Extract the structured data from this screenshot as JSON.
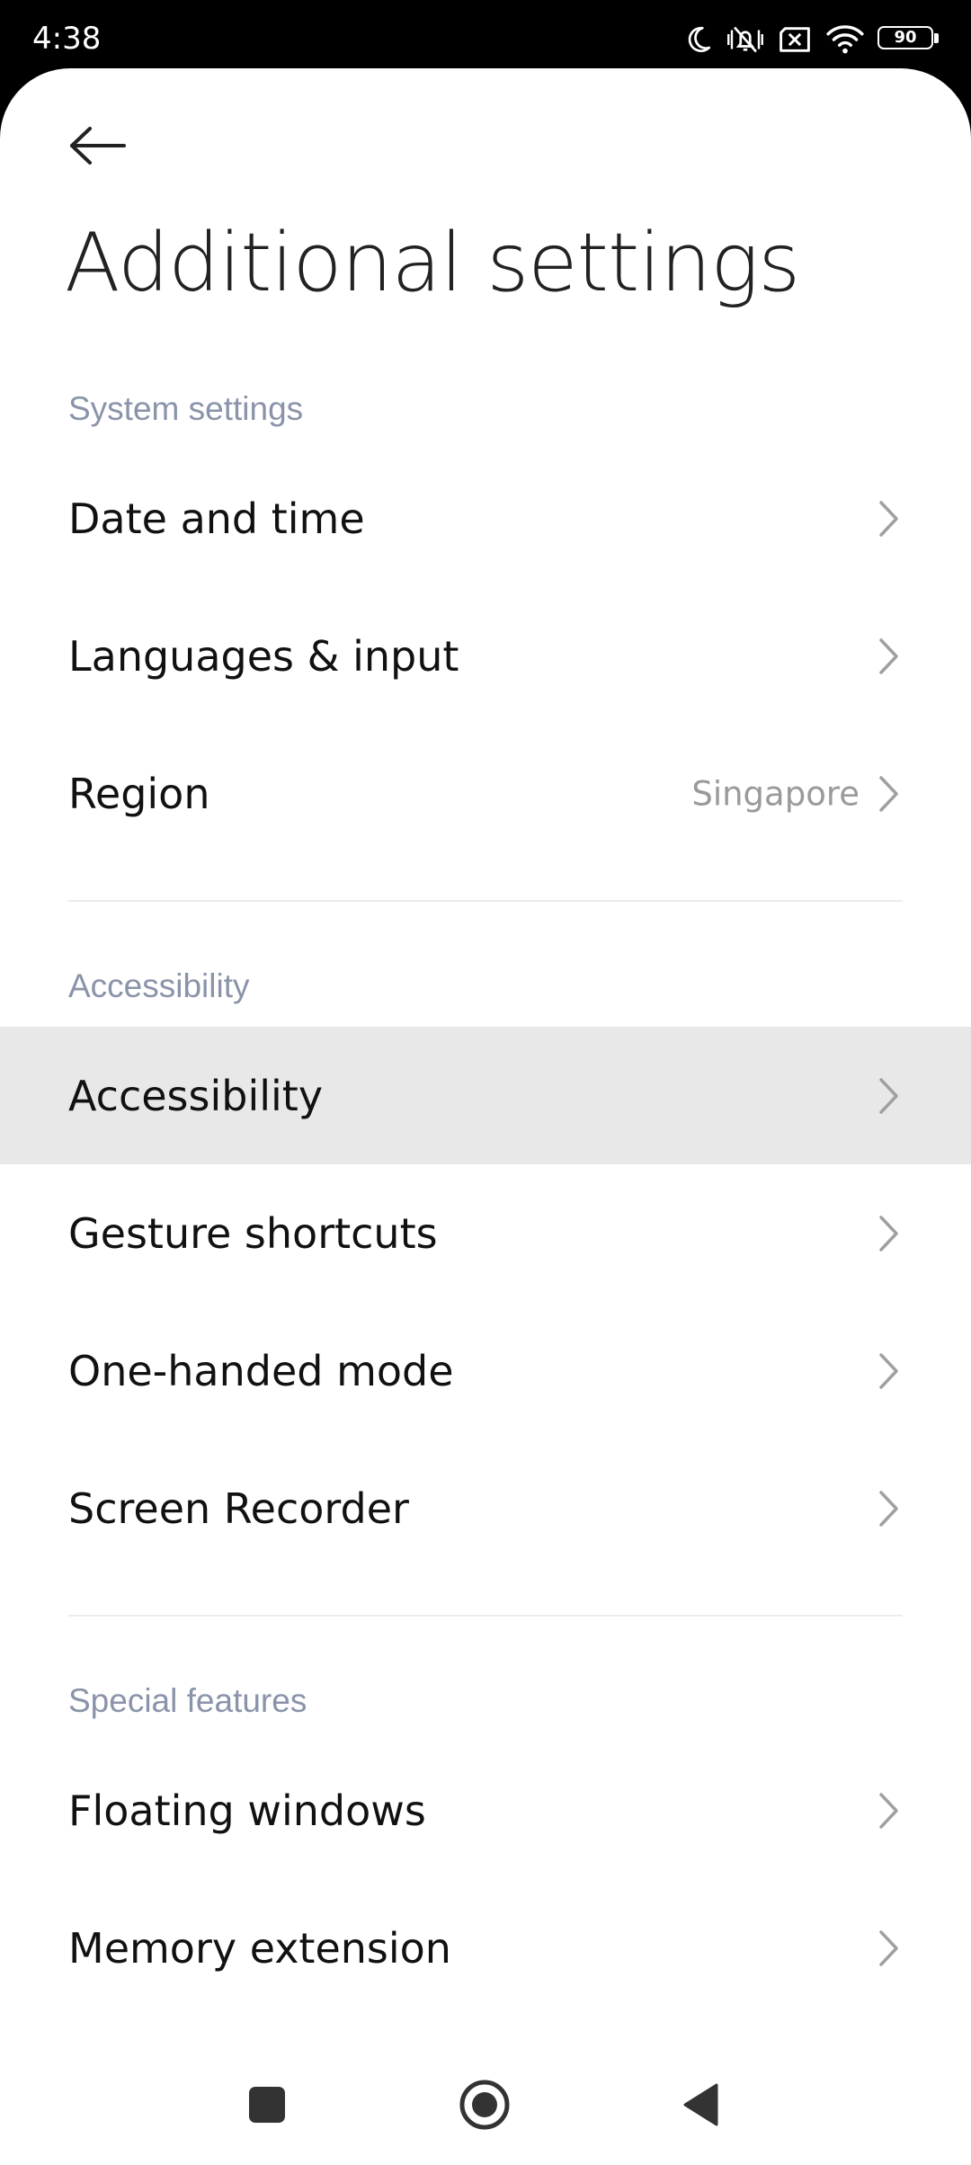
{
  "status_bar": {
    "time": "4:38",
    "battery_level": "90",
    "icons": [
      "moon-icon",
      "vibrate-silent-icon",
      "no-sim-icon",
      "wifi-icon",
      "battery-icon"
    ]
  },
  "header": {
    "back_icon": "arrow-left-icon",
    "title": "Additional settings"
  },
  "sections": [
    {
      "header": "System settings",
      "items": [
        {
          "label": "Date and time",
          "value": ""
        },
        {
          "label": "Languages & input",
          "value": ""
        },
        {
          "label": "Region",
          "value": "Singapore"
        }
      ]
    },
    {
      "header": "Accessibility",
      "items": [
        {
          "label": "Accessibility",
          "value": "",
          "highlighted": true
        },
        {
          "label": "Gesture shortcuts",
          "value": ""
        },
        {
          "label": "One-handed mode",
          "value": ""
        },
        {
          "label": "Screen Recorder",
          "value": ""
        }
      ]
    },
    {
      "header": "Special features",
      "items": [
        {
          "label": "Floating windows",
          "value": ""
        },
        {
          "label": "Memory extension",
          "value": ""
        }
      ]
    }
  ],
  "nav_bar": {
    "icons": [
      "recents-square-icon",
      "home-circle-icon",
      "back-triangle-icon"
    ]
  },
  "colors": {
    "section_header": "#8a93a9",
    "highlight": "#e8e8e8",
    "chevron": "#a0a0a0"
  }
}
